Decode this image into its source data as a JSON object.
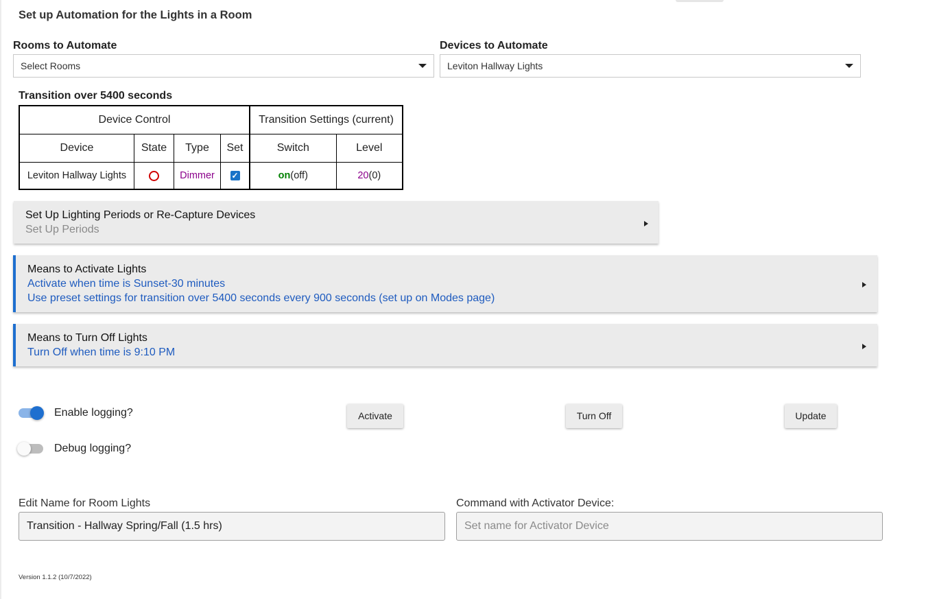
{
  "page_title": "Set up Automation for the Lights in a Room",
  "rooms": {
    "label": "Rooms to Automate",
    "value": "Select Rooms"
  },
  "devices": {
    "label": "Devices to Automate",
    "value": "Leviton Hallway Lights"
  },
  "transition": {
    "title": "Transition over 5400 seconds",
    "group_headers": [
      "Device Control",
      "Transition Settings (current)"
    ],
    "columns": [
      "Device",
      "State",
      "Type",
      "Set",
      "Switch",
      "Level"
    ],
    "rows": [
      {
        "device": "Leviton Hallway Lights",
        "state": "off",
        "type": "Dimmer",
        "set": true,
        "switch_value": "on",
        "switch_current": "(off)",
        "level_value": "20",
        "level_current": "(0)"
      }
    ]
  },
  "panels": {
    "periods": {
      "title": "Set Up Lighting Periods or Re-Capture Devices",
      "sub": "Set Up Periods"
    },
    "activate": {
      "title": "Means to Activate Lights",
      "line1": "Activate when time is Sunset-30 minutes",
      "line2": "Use preset settings for transition over 5400 seconds every 900 seconds (set up on Modes page)"
    },
    "turn_off": {
      "title": "Means to Turn Off Lights",
      "line1": "Turn Off when time is 9:10 PM"
    }
  },
  "toggles": {
    "enable_logging": {
      "label": "Enable logging?",
      "on": true
    },
    "debug_logging": {
      "label": "Debug logging?",
      "on": false
    }
  },
  "buttons": {
    "activate": "Activate",
    "turn_off": "Turn Off",
    "update": "Update"
  },
  "name_field": {
    "label": "Edit Name for Room Lights",
    "value": "Transition - Hallway Spring/Fall (1.5 hrs)"
  },
  "activator_field": {
    "label": "Command with Activator Device:",
    "placeholder": "Set name for Activator Device"
  },
  "version": "Version 1.1.2 (10/7/2022)",
  "colors": {
    "accent": "#1e6fcf",
    "link_blue": "#1e5bbf",
    "purple": "#8b008b",
    "green": "#008000",
    "state_red": "#d00000"
  }
}
